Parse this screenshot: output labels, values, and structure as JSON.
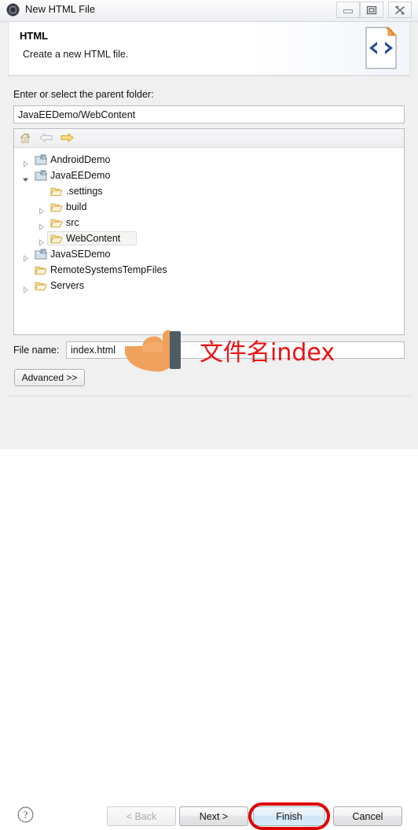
{
  "window": {
    "title": "New HTML File",
    "icon": "eclipse-wizard-icon",
    "controls": {
      "minimize": "minimize-icon",
      "maximize": "maximize-icon",
      "close": "close-icon"
    }
  },
  "header": {
    "title": "HTML",
    "description": "Create a new HTML file.",
    "icon": "html-file-icon"
  },
  "form": {
    "parent_folder_label": "Enter or select the parent folder:",
    "parent_folder_value": "JavaEEDemo/WebContent",
    "file_name_label": "File name:",
    "file_name_value": "index.html",
    "advanced_label": "Advanced >>"
  },
  "tree_toolbar": {
    "home": "home-icon",
    "back": "back-arrow-icon",
    "forward": "forward-arrow-icon"
  },
  "tree": {
    "items": [
      {
        "label": "AndroidDemo",
        "depth": 0,
        "expander": "collapsed",
        "icon": "project-icon",
        "selected": false
      },
      {
        "label": "JavaEEDemo",
        "depth": 0,
        "expander": "expanded",
        "icon": "project-icon",
        "selected": false
      },
      {
        "label": ".settings",
        "depth": 1,
        "expander": "none",
        "icon": "folder-icon",
        "selected": false
      },
      {
        "label": "build",
        "depth": 1,
        "expander": "collapsed",
        "icon": "folder-icon",
        "selected": false
      },
      {
        "label": "src",
        "depth": 1,
        "expander": "collapsed",
        "icon": "folder-icon",
        "selected": false
      },
      {
        "label": "WebContent",
        "depth": 1,
        "expander": "collapsed",
        "icon": "folder-icon",
        "selected": true
      },
      {
        "label": "JavaSEDemo",
        "depth": 0,
        "expander": "collapsed",
        "icon": "project-icon",
        "selected": false
      },
      {
        "label": "RemoteSystemsTempFiles",
        "depth": 0,
        "expander": "none",
        "icon": "folder-icon",
        "selected": false
      },
      {
        "label": "Servers",
        "depth": 0,
        "expander": "collapsed",
        "icon": "folder-icon",
        "selected": false
      }
    ]
  },
  "footer": {
    "help": "help-icon",
    "back_label": "< Back",
    "next_label": "Next >",
    "finish_label": "Finish",
    "cancel_label": "Cancel"
  },
  "annotations": {
    "note_text": "文件名index",
    "note_color": "#ee1111",
    "highlight_color": "#e00000",
    "cursor": "pointing-hand-cursor"
  }
}
